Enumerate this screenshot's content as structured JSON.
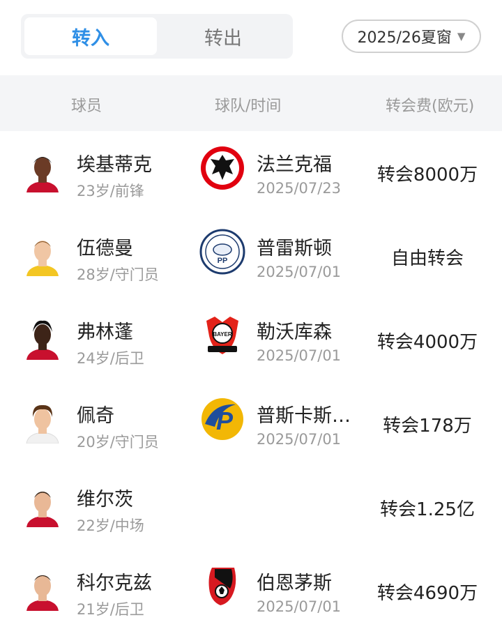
{
  "tabs": [
    "转入",
    "转出"
  ],
  "season": {
    "label": "2025/26夏窗"
  },
  "columns": {
    "player": "球员",
    "team": "球队/时间",
    "fee": "转会费(欧元)"
  },
  "transfers": [
    {
      "name": "埃基蒂克",
      "meta": "23岁/前锋",
      "team": "法兰克福",
      "date": "2025/07/23",
      "fee": "转会8000万"
    },
    {
      "name": "伍德曼",
      "meta": "28岁/守门员",
      "team": "普雷斯顿",
      "date": "2025/07/01",
      "fee": "自由转会"
    },
    {
      "name": "弗林蓬",
      "meta": "24岁/后卫",
      "team": "勒沃库森",
      "date": "2025/07/01",
      "fee": "转会4000万"
    },
    {
      "name": "佩奇",
      "meta": "20岁/守门员",
      "team": "普斯卡斯…",
      "date": "2025/07/01",
      "fee": "转会178万"
    },
    {
      "name": "维尔茨",
      "meta": "22岁/中场",
      "team": "",
      "date": "",
      "fee": "转会1.25亿"
    },
    {
      "name": "科尔克兹",
      "meta": "21岁/后卫",
      "team": "伯恩茅斯",
      "date": "2025/07/01",
      "fee": "转会4690万"
    }
  ],
  "colors": {
    "accent": "#2f8fe6"
  }
}
